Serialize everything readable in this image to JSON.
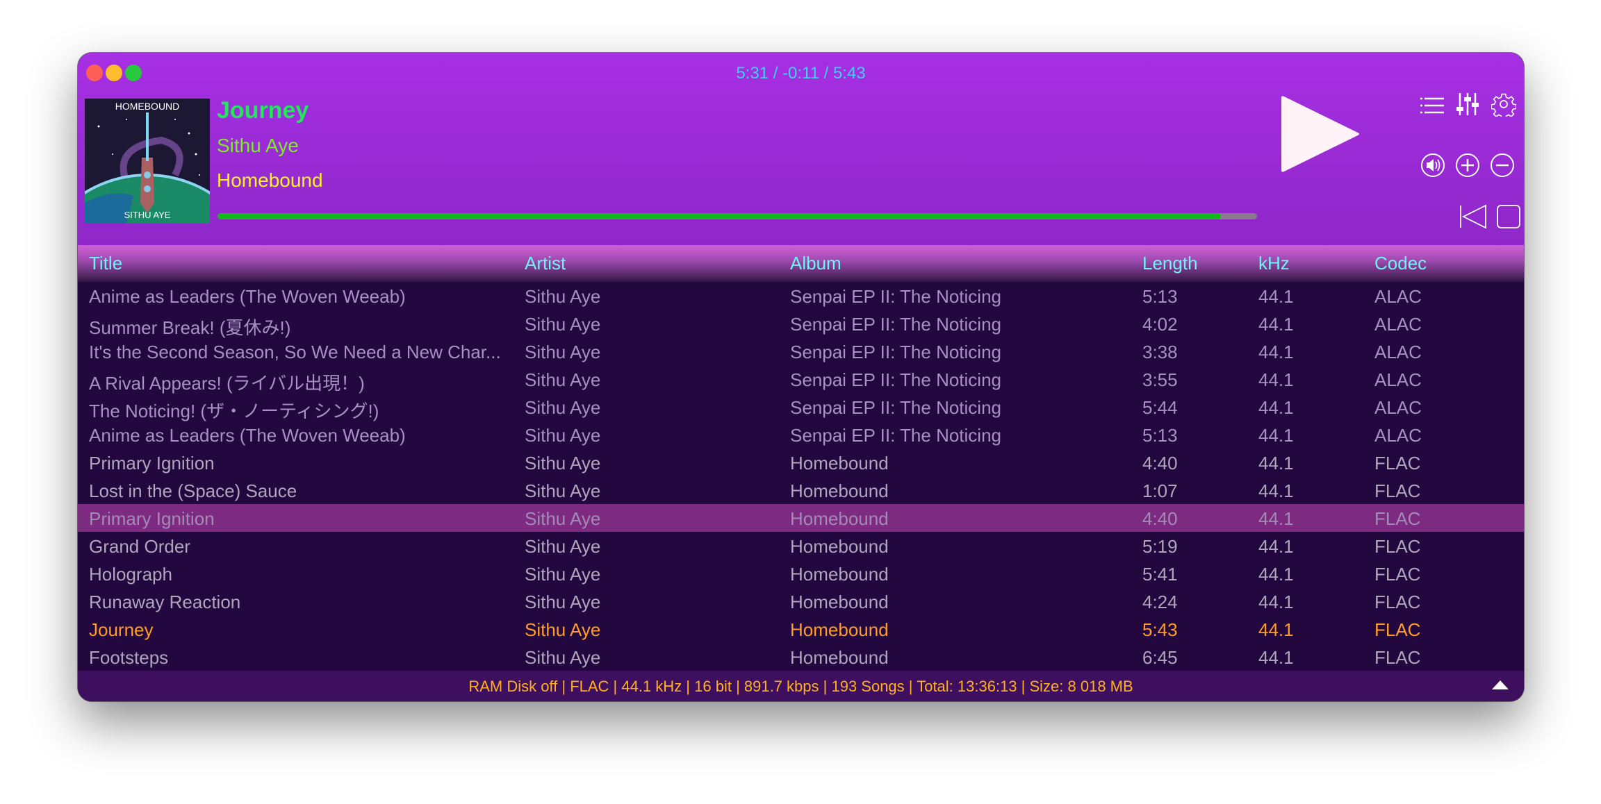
{
  "window": {
    "time_display": "5:31 / -0:11 / 5:43"
  },
  "now_playing": {
    "title": "Journey",
    "artist": "Sithu Aye",
    "album": "Homebound",
    "art_top_text": "HOMEBOUND",
    "art_bottom_text": "SITHU AYE",
    "progress_percent": 96.5
  },
  "colors": {
    "title": "#22e65c",
    "artist": "#7dec2a",
    "album": "#fff02a",
    "progress": "#12b81c",
    "header_text": "#6ff3f6",
    "playing_row": "#ff9c2a",
    "selected_row": "#7c2b80",
    "status_text": "#ffb020"
  },
  "icons": [
    "playlist-icon",
    "equalizer-icon",
    "gear-icon",
    "volume-icon",
    "plus-icon",
    "minus-icon",
    "previous-icon",
    "stop-icon",
    "pause-icon",
    "next-icon",
    "play-icon",
    "chevron-up-icon"
  ],
  "columns": [
    "Title",
    "Artist",
    "Album",
    "Length",
    "kHz",
    "Codec"
  ],
  "tracks": [
    [
      "Anime as Leaders (The Woven Weeab)",
      "Sithu Aye",
      "Senpai EP II: The Noticing",
      "5:13",
      "44.1",
      "ALAC"
    ],
    [
      "Summer Break! (夏休み!)",
      "Sithu Aye",
      "Senpai EP II: The Noticing",
      "4:02",
      "44.1",
      "ALAC"
    ],
    [
      "It's the Second Season, So We Need a New Char...",
      "Sithu Aye",
      "Senpai EP II: The Noticing",
      "3:38",
      "44.1",
      "ALAC"
    ],
    [
      "A Rival Appears! (ライバル出現！)",
      "Sithu Aye",
      "Senpai EP II: The Noticing",
      "3:55",
      "44.1",
      "ALAC"
    ],
    [
      "The Noticing! (ザ・ノーティシング!)",
      "Sithu Aye",
      "Senpai EP II: The Noticing",
      "5:44",
      "44.1",
      "ALAC"
    ],
    [
      "Anime as Leaders (The Woven Weeab)",
      "Sithu Aye",
      "Senpai EP II: The Noticing",
      "5:13",
      "44.1",
      "ALAC"
    ],
    [
      "Primary Ignition",
      "Sithu Aye",
      "Homebound",
      "4:40",
      "44.1",
      "FLAC"
    ],
    [
      "Lost in the (Space) Sauce",
      "Sithu Aye",
      "Homebound",
      "1:07",
      "44.1",
      "FLAC"
    ],
    [
      "Primary Ignition",
      "Sithu Aye",
      "Homebound",
      "4:40",
      "44.1",
      "FLAC"
    ],
    [
      "Grand Order",
      "Sithu Aye",
      "Homebound",
      "5:19",
      "44.1",
      "FLAC"
    ],
    [
      "Holograph",
      "Sithu Aye",
      "Homebound",
      "5:41",
      "44.1",
      "FLAC"
    ],
    [
      "Runaway Reaction",
      "Sithu Aye",
      "Homebound",
      "4:24",
      "44.1",
      "FLAC"
    ],
    [
      "Journey",
      "Sithu Aye",
      "Homebound",
      "5:43",
      "44.1",
      "FLAC"
    ],
    [
      "Footsteps",
      "Sithu Aye",
      "Homebound",
      "6:45",
      "44.1",
      "FLAC"
    ]
  ],
  "selected_index": 8,
  "playing_index": 12,
  "status": "RAM Disk off | FLAC | 44.1 kHz | 16 bit | 891.7 kbps | 193 Songs | Total: 13:36:13 | Size: 8 018 MB"
}
